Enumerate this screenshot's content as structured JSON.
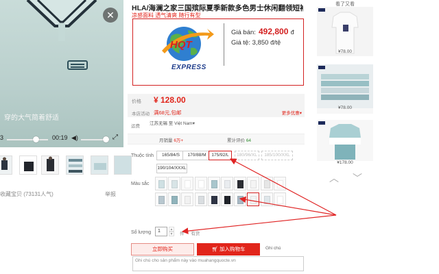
{
  "video": {
    "caption": "穿的大气简着舒适",
    "time_current": "3",
    "time_total": "00:19"
  },
  "gallery": {
    "views_line": "收藏宝贝   (73131人气)",
    "report_link": "举报"
  },
  "product": {
    "title": "HLA/海澜之家三国殡际夏季新款多色男士休闲翻领短袖商务polo衫男",
    "subtitle": "凉感面料 透气清爽 随行有型"
  },
  "banner": {
    "logo_top_text": "HQT",
    "logo_bottom_text": "EXPRESS",
    "price_label": "Giá bán:",
    "price_value": "492,800",
    "price_unit": "đ",
    "rate_label": "Giá tệ:",
    "rate_value": "3,850",
    "rate_unit": "đ/tệ"
  },
  "pricing": {
    "price_label": "价格",
    "price_value": "¥ 128.00",
    "promo_label": "本店活动",
    "promo_value": "满68元,包邮",
    "promo_more": "更多优惠▾"
  },
  "shipping": {
    "label": "运费",
    "value": "江苏无锡 至 Việt Nam▾"
  },
  "stats": {
    "sales_label": "月销量",
    "sales_value": "6万+",
    "reviews_label": "累计评价",
    "reviews_value": "64"
  },
  "size": {
    "label": "Thuộc tính",
    "options": [
      {
        "label": "165/84/S",
        "state": "normal"
      },
      {
        "label": "170/88/M",
        "state": "normal"
      },
      {
        "label": "175/92/L",
        "state": "selected"
      },
      {
        "label": "180/96/XL",
        "state": "disabled"
      },
      {
        "label": "185/100/XXL",
        "state": "disabled"
      },
      {
        "label": "190/104/XXXL",
        "state": "normal"
      }
    ]
  },
  "color": {
    "label": "Màu sắc",
    "swatches": [
      "#cfe0e3",
      "#d8e4e6",
      "#ffffff",
      "#ffffff",
      "#a9c6cc",
      "#e9ecef",
      "#2b2d33",
      "#f4f4f4",
      "#e6e6e6",
      "#ffffff",
      "#b8c7cf",
      "#90b3bb",
      "#f1f1f1",
      "#d9dde0",
      "#2e3444",
      "#20232a",
      "#a8b8c4",
      "#f3f3f3",
      "#dfe6ea",
      "#ffffff"
    ],
    "selected_index": 17
  },
  "quantity": {
    "label": "Số lượng",
    "value": "1",
    "unit": "件",
    "stock": "有货"
  },
  "actions": {
    "buy_now": "立即购买",
    "add_to_cart": "加入购物车",
    "note_label": "Ghi chú",
    "note_placeholder": "Ghi chú cho sản phẩm này vào muahangquocte.vn"
  },
  "recommendations": {
    "title": "看了又看",
    "items": [
      {
        "price": "¥78.00"
      },
      {
        "price": "¥78.00"
      },
      {
        "price": "¥178.00"
      }
    ],
    "prev_icon": "chevron-up",
    "next_icon": "chevron-down"
  },
  "colors": {
    "accent_red": "#e1251b",
    "banner_border": "#d32020"
  }
}
